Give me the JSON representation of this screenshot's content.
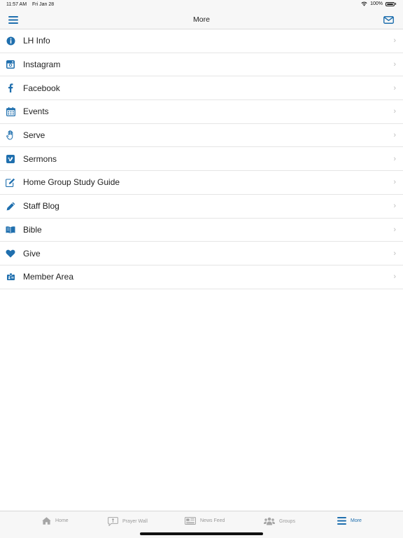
{
  "status": {
    "time": "11:57 AM",
    "date": "Fri Jan 28",
    "battery": "100%"
  },
  "navbar": {
    "title": "More",
    "menu_icon": "hamburger-icon",
    "mail_icon": "envelope-icon"
  },
  "accent": "#1f6fae",
  "items": [
    {
      "label": "LH Info",
      "icon": "info-circle-icon"
    },
    {
      "label": "Instagram",
      "icon": "instagram-icon"
    },
    {
      "label": "Facebook",
      "icon": "facebook-icon"
    },
    {
      "label": "Events",
      "icon": "calendar-icon"
    },
    {
      "label": "Serve",
      "icon": "hand-icon"
    },
    {
      "label": "Sermons",
      "icon": "vimeo-icon"
    },
    {
      "label": "Home Group Study Guide",
      "icon": "edit-icon"
    },
    {
      "label": "Staff Blog",
      "icon": "pencil-icon"
    },
    {
      "label": "Bible",
      "icon": "book-icon"
    },
    {
      "label": "Give",
      "icon": "heart-icon"
    },
    {
      "label": "Member Area",
      "icon": "id-card-icon"
    }
  ],
  "tabs": [
    {
      "label": "Home",
      "icon": "home-icon"
    },
    {
      "label": "Prayer Wall",
      "icon": "prayer-bubble-icon"
    },
    {
      "label": "News Feed",
      "icon": "newspaper-icon"
    },
    {
      "label": "Groups",
      "icon": "users-icon"
    },
    {
      "label": "More",
      "icon": "hamburger-icon"
    }
  ]
}
